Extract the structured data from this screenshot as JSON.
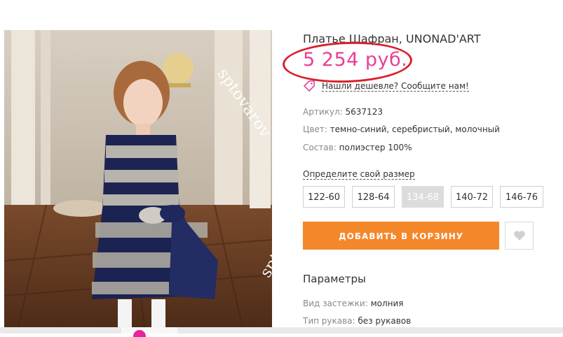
{
  "product": {
    "title": "Платье Шафран, UNONAD'ART",
    "price": "5 254 руб.",
    "cheaper_link": "Нашли дешевле? Сообщите нам!",
    "article_label": "Артикул:",
    "article_value": "5637123",
    "color_label": "Цвет:",
    "color_value": "темно-синий, серебристый, молочный",
    "material_label": "Состав:",
    "material_value": "полиэстер 100%"
  },
  "sizes": {
    "hint": "Определите свой размер",
    "options": [
      {
        "label": "122-60",
        "available": true
      },
      {
        "label": "128-64",
        "available": true
      },
      {
        "label": "134-68",
        "available": false
      },
      {
        "label": "140-72",
        "available": true
      },
      {
        "label": "146-76",
        "available": true
      }
    ]
  },
  "actions": {
    "add_to_cart": "ДОБАВИТЬ В КОРЗИНУ",
    "favorite_icon": "heart-icon"
  },
  "params": {
    "heading": "Параметры",
    "fastener_label": "Вид застежки:",
    "fastener_value": "молния",
    "sleeve_label": "Тип рукава:",
    "sleeve_value": "без рукавов"
  },
  "watermark": "sptovarov",
  "colors": {
    "price": "#ea3f95",
    "cart_button": "#f4872a",
    "highlight_ring": "#d9202a"
  }
}
